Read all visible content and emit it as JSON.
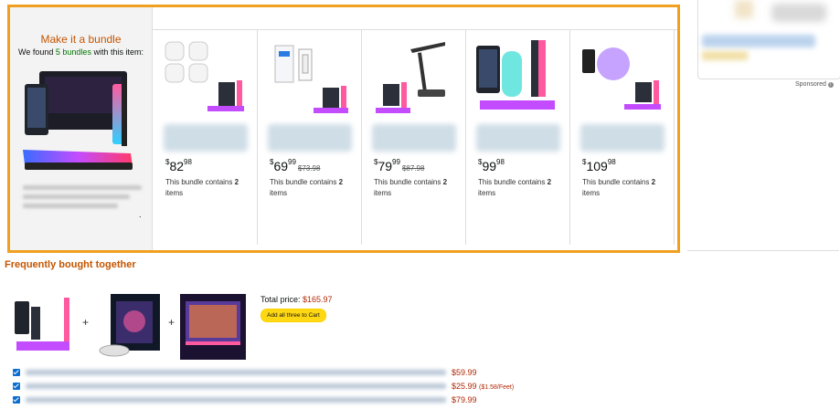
{
  "bundle": {
    "title": "Make it a bundle",
    "subtitle_prefix": "We found ",
    "subtitle_count": "5 bundles",
    "subtitle_suffix": " with this item:",
    "trailing": ".",
    "cards": [
      {
        "price_whole": "82",
        "price_frac": "98",
        "old_price": "",
        "desc_prefix": "This bundle contains ",
        "desc_count": "2",
        "desc_suffix": "items"
      },
      {
        "price_whole": "69",
        "price_frac": "99",
        "old_price": "$73.98",
        "desc_prefix": "This bundle contains ",
        "desc_count": "2",
        "desc_suffix": "items"
      },
      {
        "price_whole": "79",
        "price_frac": "99",
        "old_price": "$87.98",
        "desc_prefix": "This bundle contains ",
        "desc_count": "2",
        "desc_suffix": "items"
      },
      {
        "price_whole": "99",
        "price_frac": "98",
        "old_price": "",
        "desc_prefix": "This bundle contains ",
        "desc_count": "2",
        "desc_suffix": "items"
      },
      {
        "price_whole": "109",
        "price_frac": "98",
        "old_price": "",
        "desc_prefix": "This bundle contains ",
        "desc_count": "2",
        "desc_suffix": "items"
      }
    ]
  },
  "sponsored": {
    "label": "Sponsored",
    "icon": "info-icon"
  },
  "fbt": {
    "title": "Frequently bought together",
    "total_label": "Total price: ",
    "total_value": "$165.97",
    "cart_button": "Add all three to Cart",
    "plus": "+",
    "rows": [
      {
        "price": "$59.99",
        "unit": ""
      },
      {
        "price": "$25.99",
        "unit": "($1.58/Feet)"
      },
      {
        "price": "$79.99",
        "unit": ""
      }
    ]
  },
  "colors": {
    "accent_orange": "#f0a020",
    "price_red": "#b12704",
    "title_orange": "#c45500",
    "cart_yellow": "#ffd814"
  }
}
